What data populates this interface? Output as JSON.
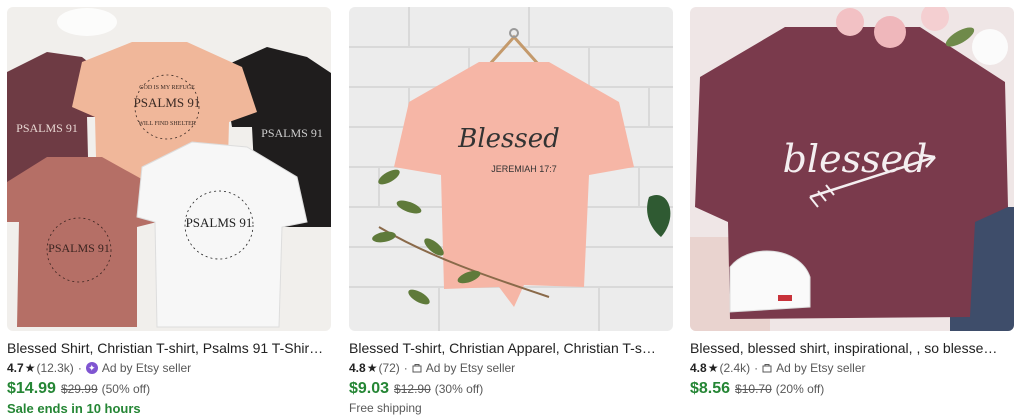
{
  "listings": [
    {
      "title": "Blessed Shirt, Christian T-shirt, Psalms 91 T-Shir…",
      "rating": "4.7",
      "reviews": "(12.3k)",
      "dot": "·",
      "seller_label": "Ad by Etsy seller",
      "seller_icon": "star-seller-badge-icon",
      "price": "$14.99",
      "original_price": "$29.99",
      "discount": "(50% off)",
      "extra": "Sale ends in 10 hours",
      "shirt_texts": [
        "GOD IS MY REFUGE",
        "PSALMS 91",
        "WILL FIND SHELTER"
      ],
      "colors": {
        "maroon": "#6e3b44",
        "peach": "#f0b79a",
        "black": "#1f1d1d",
        "rose": "#b56f66",
        "white": "#f7f7f7"
      }
    },
    {
      "title": "Blessed T-shirt, Christian Apparel, Christian T-s…",
      "rating": "4.8",
      "reviews": "(72)",
      "dot": "·",
      "seller_label": "Ad by Etsy seller",
      "seller_icon": "ad-icon",
      "price": "$9.03",
      "original_price": "$12.90",
      "discount": "(30% off)",
      "extra": "Free shipping",
      "shirt_texts": [
        "Blessed",
        "JEREMIAH 17:7"
      ],
      "colors": {
        "shirt": "#f6b6a6",
        "wall": "#ececec"
      }
    },
    {
      "title": "Blessed, blessed shirt, inspirational, , so blesse…",
      "rating": "4.8",
      "reviews": "(2.4k)",
      "dot": "·",
      "seller_label": "Ad by Etsy seller",
      "seller_icon": "ad-icon",
      "price": "$8.56",
      "original_price": "$10.70",
      "discount": "(20% off)",
      "extra": "",
      "shirt_texts": [
        "blessed"
      ],
      "colors": {
        "shirt": "#7a3a4c",
        "flowers": "#f2c1c4"
      }
    }
  ],
  "ui": {
    "star_glyph": "★",
    "price_color": "#258635"
  }
}
